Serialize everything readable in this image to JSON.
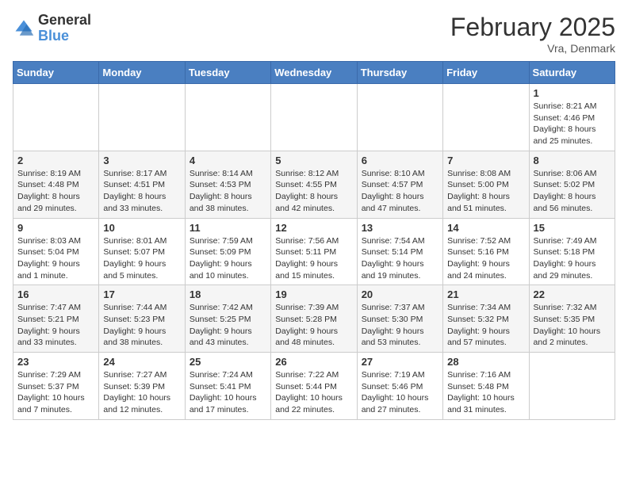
{
  "header": {
    "logo_general": "General",
    "logo_blue": "Blue",
    "month_title": "February 2025",
    "location": "Vra, Denmark"
  },
  "days_of_week": [
    "Sunday",
    "Monday",
    "Tuesday",
    "Wednesday",
    "Thursday",
    "Friday",
    "Saturday"
  ],
  "weeks": [
    [
      {
        "day": "",
        "info": ""
      },
      {
        "day": "",
        "info": ""
      },
      {
        "day": "",
        "info": ""
      },
      {
        "day": "",
        "info": ""
      },
      {
        "day": "",
        "info": ""
      },
      {
        "day": "",
        "info": ""
      },
      {
        "day": "1",
        "info": "Sunrise: 8:21 AM\nSunset: 4:46 PM\nDaylight: 8 hours and 25 minutes."
      }
    ],
    [
      {
        "day": "2",
        "info": "Sunrise: 8:19 AM\nSunset: 4:48 PM\nDaylight: 8 hours and 29 minutes."
      },
      {
        "day": "3",
        "info": "Sunrise: 8:17 AM\nSunset: 4:51 PM\nDaylight: 8 hours and 33 minutes."
      },
      {
        "day": "4",
        "info": "Sunrise: 8:14 AM\nSunset: 4:53 PM\nDaylight: 8 hours and 38 minutes."
      },
      {
        "day": "5",
        "info": "Sunrise: 8:12 AM\nSunset: 4:55 PM\nDaylight: 8 hours and 42 minutes."
      },
      {
        "day": "6",
        "info": "Sunrise: 8:10 AM\nSunset: 4:57 PM\nDaylight: 8 hours and 47 minutes."
      },
      {
        "day": "7",
        "info": "Sunrise: 8:08 AM\nSunset: 5:00 PM\nDaylight: 8 hours and 51 minutes."
      },
      {
        "day": "8",
        "info": "Sunrise: 8:06 AM\nSunset: 5:02 PM\nDaylight: 8 hours and 56 minutes."
      }
    ],
    [
      {
        "day": "9",
        "info": "Sunrise: 8:03 AM\nSunset: 5:04 PM\nDaylight: 9 hours and 1 minute."
      },
      {
        "day": "10",
        "info": "Sunrise: 8:01 AM\nSunset: 5:07 PM\nDaylight: 9 hours and 5 minutes."
      },
      {
        "day": "11",
        "info": "Sunrise: 7:59 AM\nSunset: 5:09 PM\nDaylight: 9 hours and 10 minutes."
      },
      {
        "day": "12",
        "info": "Sunrise: 7:56 AM\nSunset: 5:11 PM\nDaylight: 9 hours and 15 minutes."
      },
      {
        "day": "13",
        "info": "Sunrise: 7:54 AM\nSunset: 5:14 PM\nDaylight: 9 hours and 19 minutes."
      },
      {
        "day": "14",
        "info": "Sunrise: 7:52 AM\nSunset: 5:16 PM\nDaylight: 9 hours and 24 minutes."
      },
      {
        "day": "15",
        "info": "Sunrise: 7:49 AM\nSunset: 5:18 PM\nDaylight: 9 hours and 29 minutes."
      }
    ],
    [
      {
        "day": "16",
        "info": "Sunrise: 7:47 AM\nSunset: 5:21 PM\nDaylight: 9 hours and 33 minutes."
      },
      {
        "day": "17",
        "info": "Sunrise: 7:44 AM\nSunset: 5:23 PM\nDaylight: 9 hours and 38 minutes."
      },
      {
        "day": "18",
        "info": "Sunrise: 7:42 AM\nSunset: 5:25 PM\nDaylight: 9 hours and 43 minutes."
      },
      {
        "day": "19",
        "info": "Sunrise: 7:39 AM\nSunset: 5:28 PM\nDaylight: 9 hours and 48 minutes."
      },
      {
        "day": "20",
        "info": "Sunrise: 7:37 AM\nSunset: 5:30 PM\nDaylight: 9 hours and 53 minutes."
      },
      {
        "day": "21",
        "info": "Sunrise: 7:34 AM\nSunset: 5:32 PM\nDaylight: 9 hours and 57 minutes."
      },
      {
        "day": "22",
        "info": "Sunrise: 7:32 AM\nSunset: 5:35 PM\nDaylight: 10 hours and 2 minutes."
      }
    ],
    [
      {
        "day": "23",
        "info": "Sunrise: 7:29 AM\nSunset: 5:37 PM\nDaylight: 10 hours and 7 minutes."
      },
      {
        "day": "24",
        "info": "Sunrise: 7:27 AM\nSunset: 5:39 PM\nDaylight: 10 hours and 12 minutes."
      },
      {
        "day": "25",
        "info": "Sunrise: 7:24 AM\nSunset: 5:41 PM\nDaylight: 10 hours and 17 minutes."
      },
      {
        "day": "26",
        "info": "Sunrise: 7:22 AM\nSunset: 5:44 PM\nDaylight: 10 hours and 22 minutes."
      },
      {
        "day": "27",
        "info": "Sunrise: 7:19 AM\nSunset: 5:46 PM\nDaylight: 10 hours and 27 minutes."
      },
      {
        "day": "28",
        "info": "Sunrise: 7:16 AM\nSunset: 5:48 PM\nDaylight: 10 hours and 31 minutes."
      },
      {
        "day": "",
        "info": ""
      }
    ]
  ]
}
